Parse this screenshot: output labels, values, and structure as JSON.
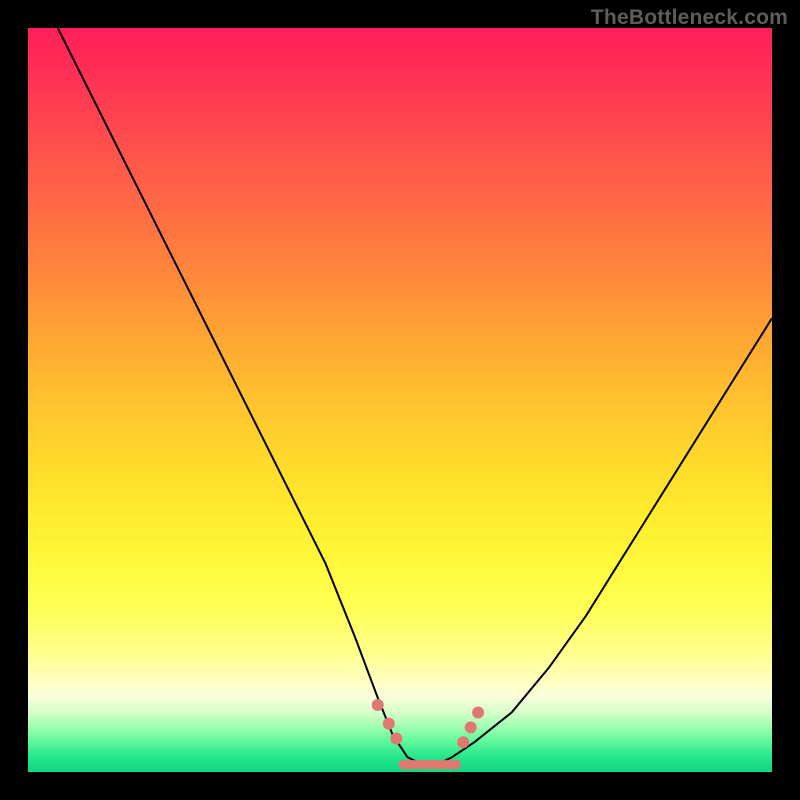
{
  "watermark": "TheBottleneck.com",
  "colors": {
    "frame": "#000000",
    "curve": "#000000",
    "marker": "#e0786f"
  },
  "chart_data": {
    "type": "line",
    "title": "",
    "xlabel": "",
    "ylabel": "",
    "xlim": [
      0,
      100
    ],
    "ylim": [
      0,
      100
    ],
    "grid": false,
    "legend": false,
    "series": [
      {
        "name": "bottleneck-curve",
        "x": [
          4,
          10,
          15,
          20,
          25,
          30,
          35,
          40,
          44,
          47,
          49,
          51,
          53,
          55,
          57,
          60,
          65,
          70,
          75,
          80,
          85,
          90,
          95,
          100
        ],
        "y": [
          100,
          88,
          78,
          68,
          58,
          48,
          38,
          28,
          18,
          10,
          5,
          2,
          1,
          1,
          2,
          4,
          8,
          14,
          21,
          29,
          37,
          45,
          53,
          61
        ]
      }
    ],
    "markers": {
      "name": "valley-points",
      "x": [
        47,
        48.5,
        49.5,
        58.5,
        59.5,
        60.5
      ],
      "y": [
        9,
        6.5,
        4.5,
        4,
        6,
        8
      ]
    },
    "floor_segment": {
      "x_start": 50.5,
      "x_end": 57.5,
      "y": 1
    },
    "background_gradient_stops": [
      {
        "pos": 0.0,
        "color": "#ff1f59"
      },
      {
        "pos": 0.25,
        "color": "#ff7a40"
      },
      {
        "pos": 0.5,
        "color": "#ffc22e"
      },
      {
        "pos": 0.75,
        "color": "#fff94a"
      },
      {
        "pos": 0.9,
        "color": "#f4ffd2"
      },
      {
        "pos": 1.0,
        "color": "#0fd984"
      }
    ]
  }
}
